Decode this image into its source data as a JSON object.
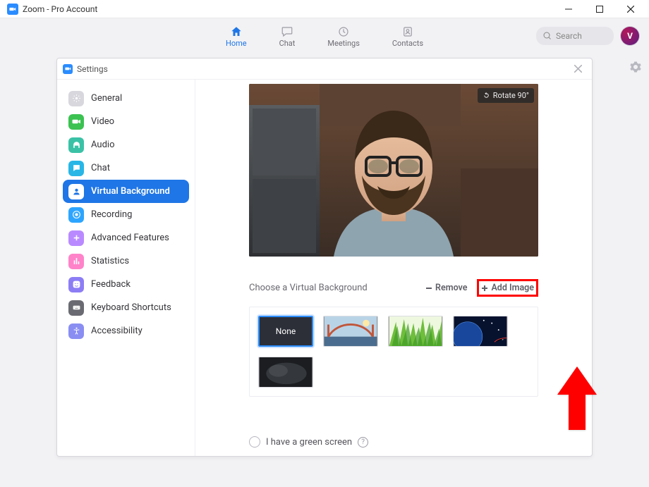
{
  "window": {
    "title": "Zoom - Pro Account"
  },
  "nav": {
    "items": [
      {
        "label": "Home",
        "icon": "home",
        "active": true
      },
      {
        "label": "Chat",
        "icon": "chat",
        "active": false
      },
      {
        "label": "Meetings",
        "icon": "clock",
        "active": false
      },
      {
        "label": "Contacts",
        "icon": "contact",
        "active": false
      }
    ],
    "search_placeholder": "Search",
    "avatar_initial": "V"
  },
  "settings": {
    "title": "Settings",
    "sidebar": [
      {
        "label": "General",
        "color": "#d7d7dd",
        "icon": "gear"
      },
      {
        "label": "Video",
        "color": "#3bc251",
        "icon": "video"
      },
      {
        "label": "Audio",
        "color": "#3bc2a6",
        "icon": "headphones"
      },
      {
        "label": "Chat",
        "color": "#28b6e6",
        "icon": "chatbubble"
      },
      {
        "label": "Virtual Background",
        "color": "#1F76E6",
        "icon": "user",
        "active": true
      },
      {
        "label": "Recording",
        "color": "#2da5ff",
        "icon": "record"
      },
      {
        "label": "Advanced Features",
        "color": "#b98aff",
        "icon": "dots"
      },
      {
        "label": "Statistics",
        "color": "#ff83c9",
        "icon": "bars"
      },
      {
        "label": "Feedback",
        "color": "#8d7df5",
        "icon": "smile"
      },
      {
        "label": "Keyboard Shortcuts",
        "color": "#6a6a72",
        "icon": "keyboard"
      },
      {
        "label": "Accessibility",
        "color": "#8a8ef2",
        "icon": "accessibility"
      }
    ],
    "preview": {
      "rotate_label": "Rotate 90°"
    },
    "vb": {
      "title": "Choose a Virtual Background",
      "remove_label": "Remove",
      "add_label": "Add Image",
      "none_label": "None",
      "thumbs": [
        "none",
        "bridge",
        "grass",
        "space",
        "dark"
      ]
    },
    "footer": {
      "green_screen_label": "I have a green screen",
      "help_symbol": "?"
    }
  }
}
